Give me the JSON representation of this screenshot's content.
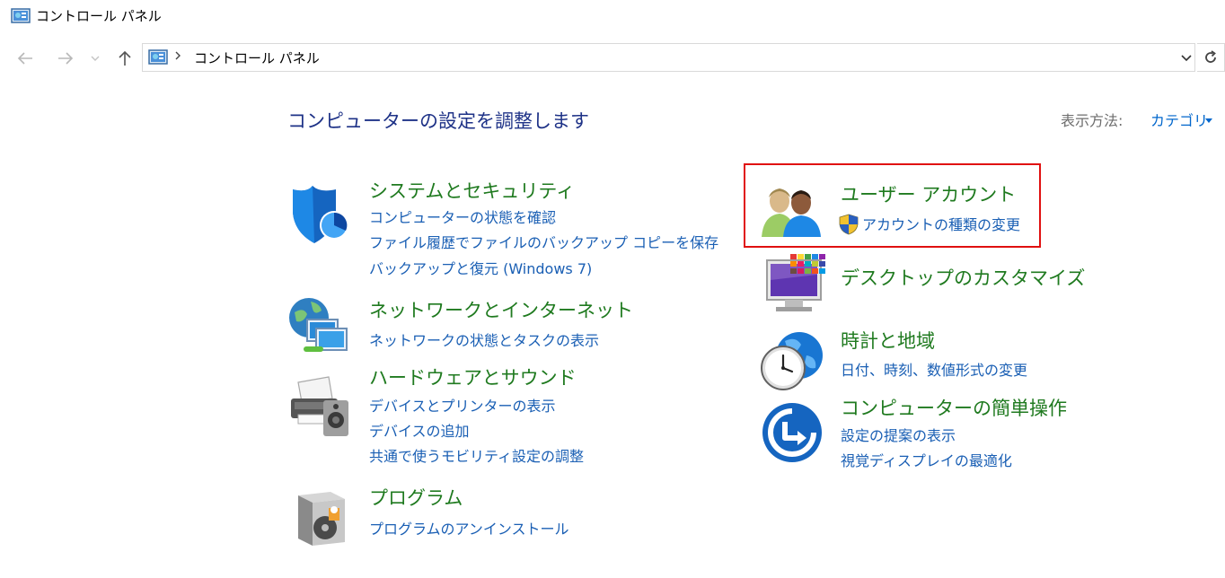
{
  "window": {
    "title": "コントロール パネル"
  },
  "address": {
    "path": "コントロール パネル"
  },
  "header": {
    "heading": "コンピューターの設定を調整します",
    "view_by_label": "表示方法:",
    "view_by_value": "カテゴリ"
  },
  "categories": {
    "system": {
      "title": "システムとセキュリティ",
      "links": [
        "コンピューターの状態を確認",
        "ファイル履歴でファイルのバックアップ コピーを保存",
        "バックアップと復元 (Windows 7)"
      ]
    },
    "network": {
      "title": "ネットワークとインターネット",
      "links": [
        "ネットワークの状態とタスクの表示"
      ]
    },
    "hardware": {
      "title": "ハードウェアとサウンド",
      "links": [
        "デバイスとプリンターの表示",
        "デバイスの追加",
        "共通で使うモビリティ設定の調整"
      ]
    },
    "programs": {
      "title": "プログラム",
      "links": [
        "プログラムのアンインストール"
      ]
    },
    "users": {
      "title": "ユーザー アカウント",
      "links": [
        "アカウントの種類の変更"
      ]
    },
    "desktop": {
      "title": "デスクトップのカスタマイズ",
      "links": []
    },
    "clock": {
      "title": "時計と地域",
      "links": [
        "日付、時刻、数値形式の変更"
      ]
    },
    "ease": {
      "title": "コンピューターの簡単操作",
      "links": [
        "設定の提案の表示",
        "視覚ディスプレイの最適化"
      ]
    }
  },
  "colors": {
    "heading": "#1e3287",
    "category": "#1f7a1f",
    "link": "#1a5fb4",
    "highlight": "#e01010"
  }
}
